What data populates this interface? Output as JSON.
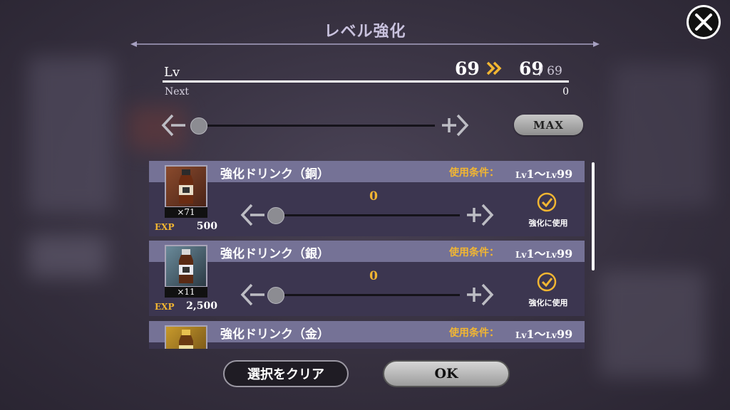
{
  "dialog": {
    "title": "レベル強化"
  },
  "level": {
    "label": "Lv",
    "current": "69",
    "new": "69",
    "max": "/ 69",
    "next_label": "Next",
    "next_value": "0"
  },
  "slider": {
    "max_button": "MAX"
  },
  "items": [
    {
      "name": "強化ドリンク（銅）",
      "condition_label": "使用条件：",
      "range_lv1": "Lv",
      "range_from": "1～",
      "range_lv2": "Lv",
      "range_to": "99",
      "count": "×71",
      "exp_label": "EXP",
      "exp_value": "500",
      "quantity": "0",
      "use_label": "強化に使用"
    },
    {
      "name": "強化ドリンク（銀）",
      "condition_label": "使用条件：",
      "range_lv1": "Lv",
      "range_from": "1～",
      "range_lv2": "Lv",
      "range_to": "99",
      "count": "×11",
      "exp_label": "EXP",
      "exp_value": "2,500",
      "quantity": "0",
      "use_label": "強化に使用"
    },
    {
      "name": "強化ドリンク（金）",
      "condition_label": "使用条件：",
      "range_lv1": "Lv",
      "range_from": "1～",
      "range_lv2": "Lv",
      "range_to": "99"
    }
  ],
  "buttons": {
    "clear": "選択をクリア",
    "ok": "OK"
  },
  "colors": {
    "accent": "#f2b632",
    "header": "#757296",
    "row_bg": "#3c3650"
  }
}
